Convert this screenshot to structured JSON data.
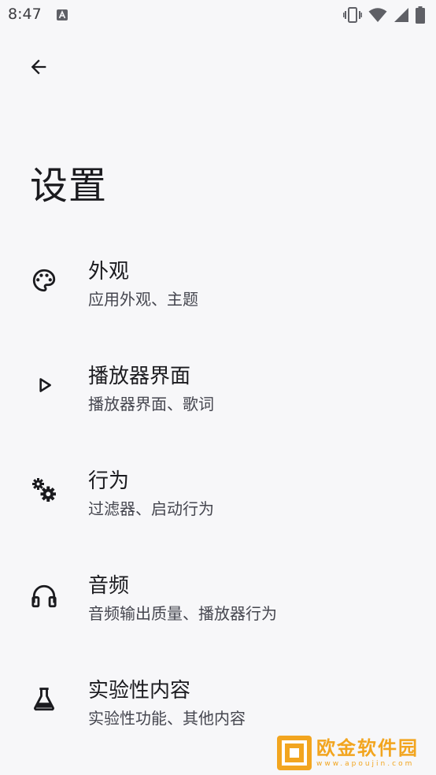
{
  "status_bar": {
    "time": "8:47",
    "icons": [
      "text-notification-icon",
      "vibrate-icon",
      "wifi-icon",
      "cell-signal-icon",
      "battery-icon"
    ]
  },
  "header": {
    "back_icon": "arrow-back-icon",
    "title": "设置"
  },
  "settings": {
    "items": [
      {
        "icon": "palette-icon",
        "title": "外观",
        "summary": "应用外观、主题"
      },
      {
        "icon": "play-icon",
        "title": "播放器界面",
        "summary": "播放器界面、歌词"
      },
      {
        "icon": "gears-icon",
        "title": "行为",
        "summary": "过滤器、启动行为"
      },
      {
        "icon": "headphones-icon",
        "title": "音频",
        "summary": "音频输出质量、播放器行为"
      },
      {
        "icon": "flask-icon",
        "title": "实验性内容",
        "summary": "实验性功能、其他内容"
      }
    ]
  },
  "watermark": {
    "main": "欧金软件园",
    "sub": "www.apoujin.com"
  },
  "colors": {
    "background": "#f7f7f9",
    "text_primary": "#1b1b1f",
    "text_secondary": "#45464f",
    "watermark": "#f2a51f"
  }
}
